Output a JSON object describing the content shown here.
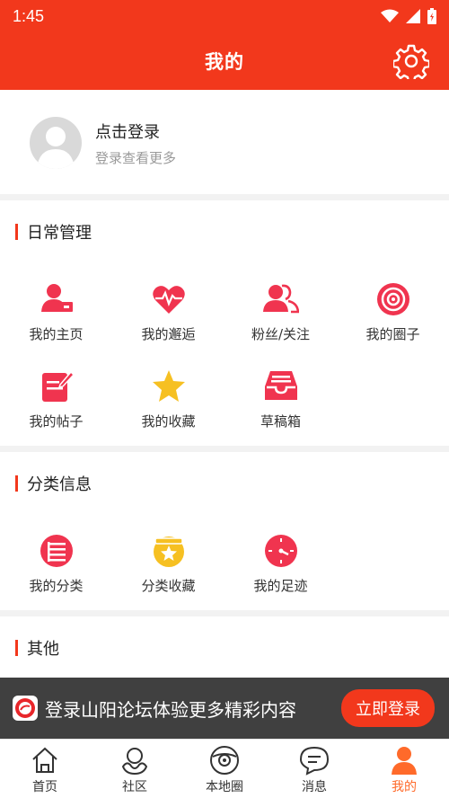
{
  "status": {
    "time": "1:45"
  },
  "header": {
    "title": "我的"
  },
  "profile": {
    "login_title": "点击登录",
    "login_sub": "登录查看更多"
  },
  "sections": {
    "daily": {
      "title": "日常管理",
      "items": [
        {
          "label": "我的主页",
          "icon": "user-home-icon"
        },
        {
          "label": "我的邂逅",
          "icon": "heart-pulse-icon"
        },
        {
          "label": "粉丝/关注",
          "icon": "followers-icon"
        },
        {
          "label": "我的圈子",
          "icon": "target-circle-icon"
        },
        {
          "label": "我的帖子",
          "icon": "post-edit-icon"
        },
        {
          "label": "我的收藏",
          "icon": "star-icon"
        },
        {
          "label": "草稿箱",
          "icon": "inbox-drafts-icon"
        }
      ]
    },
    "category": {
      "title": "分类信息",
      "items": [
        {
          "label": "我的分类",
          "icon": "list-circle-icon"
        },
        {
          "label": "分类收藏",
          "icon": "star-pot-icon"
        },
        {
          "label": "我的足迹",
          "icon": "clock-icon"
        }
      ]
    },
    "other": {
      "title": "其他"
    }
  },
  "banner": {
    "message": "登录山阳论坛体验更多精彩内容",
    "button": "立即登录"
  },
  "tabbar": {
    "items": [
      {
        "label": "首页",
        "icon": "home-icon"
      },
      {
        "label": "社区",
        "icon": "community-icon"
      },
      {
        "label": "本地圈",
        "icon": "local-circle-icon"
      },
      {
        "label": "消息",
        "icon": "message-icon"
      },
      {
        "label": "我的",
        "icon": "profile-icon",
        "active": true
      }
    ]
  },
  "colors": {
    "primary": "#f2381c",
    "icon_red": "#f0344f",
    "star": "#f6c022",
    "tab_active": "#ff6a2a"
  }
}
